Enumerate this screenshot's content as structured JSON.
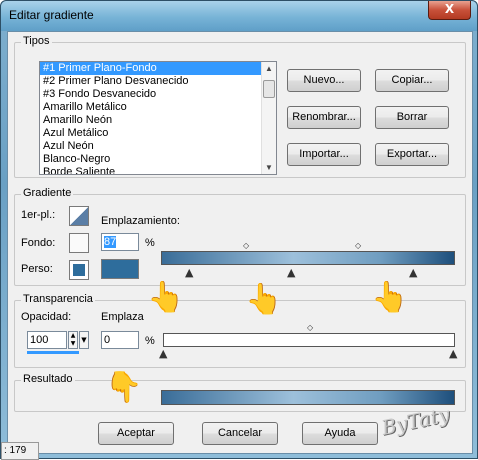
{
  "window": {
    "title": "Editar gradiente",
    "close_glyph": "X"
  },
  "tipos": {
    "group_label": "Tipos",
    "items": [
      "#1 Primer Plano-Fondo",
      "#2 Primer Plano Desvanecido",
      "#3 Fondo Desvanecido",
      "Amarillo Metálico",
      "Amarillo Neón",
      "Azul Metálico",
      "Azul Neón",
      "Blanco-Negro",
      "Borde Saliente"
    ],
    "selected_index": 0,
    "buttons": {
      "nuevo": "Nuevo...",
      "copiar": "Copiar...",
      "renombrar": "Renombrar...",
      "borrar": "Borrar",
      "importar": "Importar...",
      "exportar": "Exportar..."
    }
  },
  "gradiente": {
    "group_label": "Gradiente",
    "primer_plano_label": "1er-pl.:",
    "fondo_label": "Fondo:",
    "perso_label": "Perso:",
    "emplazamiento_label": "Emplazamiento:",
    "emplazamiento_value": "87",
    "percent": "%",
    "perso_color": "#2e6d9c"
  },
  "transparencia": {
    "group_label": "Transparencia",
    "opacidad_label": "Opacidad:",
    "opacidad_value": "100",
    "emplazamiento_label": "Emplaza",
    "emplazamiento_value": "0",
    "percent": "%"
  },
  "resultado": {
    "group_label": "Resultado"
  },
  "footer": {
    "aceptar": "Aceptar",
    "cancelar": "Cancelar",
    "ayuda": "Ayuda"
  },
  "status": {
    "text": ": 179"
  },
  "signature": "ByTaty",
  "colors": {
    "accent": "#3399ff",
    "gradient_dark": "#1e4f7c",
    "gradient_light": "#9dc0db"
  }
}
